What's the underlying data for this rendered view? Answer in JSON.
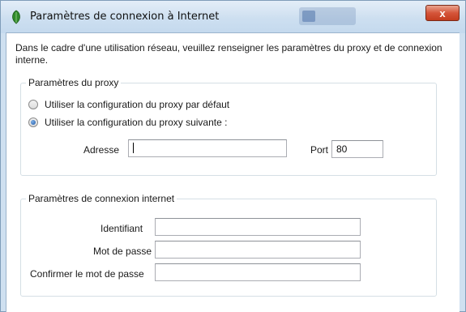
{
  "window": {
    "title": "Paramètres de connexion à Internet",
    "close_glyph": "x"
  },
  "description": "Dans le cadre d'une utilisation réseau, veuillez renseigner les paramètres du proxy et de connexion interne.",
  "proxy_group": {
    "legend": "Paramètres du proxy",
    "option_default": "Utiliser la configuration du proxy par défaut",
    "option_custom": "Utiliser la configuration du proxy suivante :",
    "selected": "custom",
    "address_label": "Adresse",
    "address_value": "",
    "port_label": "Port",
    "port_value": "80"
  },
  "connection_group": {
    "legend": "Paramètres de connexion internet",
    "login_label": "Identifiant",
    "login_value": "",
    "password_label": "Mot de passe",
    "password_value": "",
    "confirm_label": "Confirmer le mot de passe",
    "confirm_value": ""
  },
  "colors": {
    "titlebar": "#cddff0",
    "close_button": "#d5553a",
    "radio_selected": "#1f5aa8"
  },
  "icons": {
    "title_icon": "app-leaf-icon",
    "close_icon": "close-icon"
  }
}
